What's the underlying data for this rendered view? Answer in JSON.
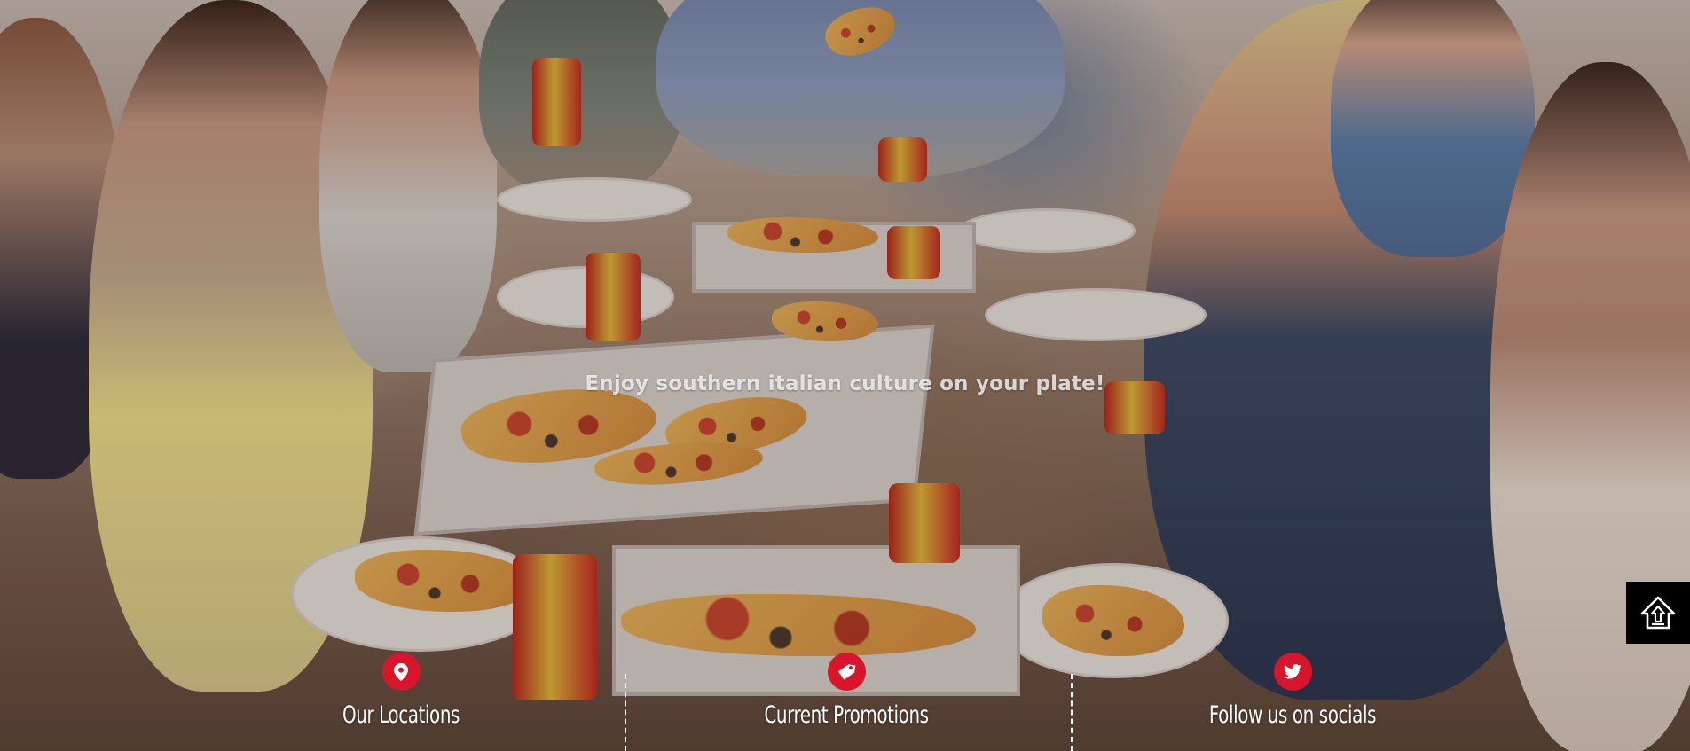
{
  "hero": {
    "tagline": "Enjoy southern italian culture on your plate!"
  },
  "features": [
    {
      "label": "Our Locations",
      "icon": "map-pin-icon"
    },
    {
      "label": "Current Promotions",
      "icon": "tag-icon"
    },
    {
      "label": "Follow us on socials",
      "icon": "twitter-icon"
    }
  ],
  "scroll_top": {
    "icon": "house-arrow-up-icon"
  },
  "colors": {
    "accent": "#d7162b",
    "text": "#ffffff",
    "scroll_button_bg": "#000000"
  }
}
